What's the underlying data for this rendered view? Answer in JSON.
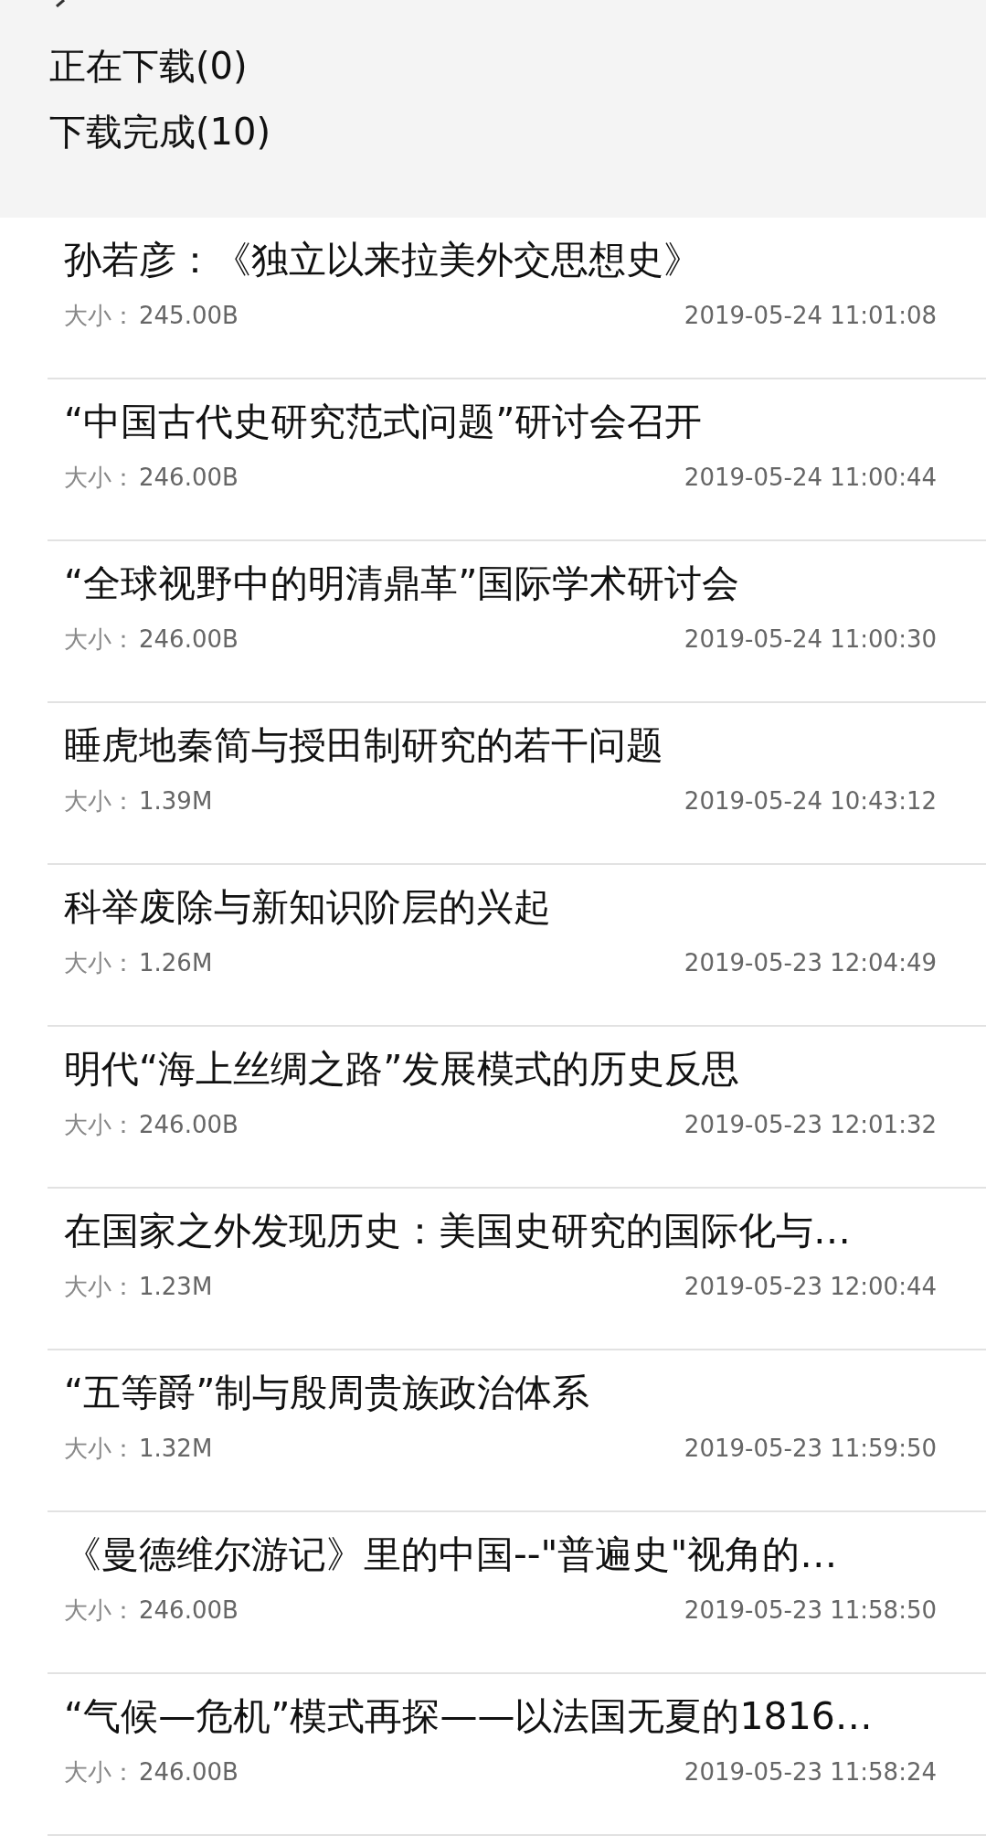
{
  "header": {
    "sections": [
      {
        "label": "正在下载(0)"
      },
      {
        "label": "下载完成(10)"
      }
    ]
  },
  "downloads": [
    {
      "title": "孙若彦：《独立以来拉美外交思想史》",
      "size_label": "大小：",
      "size": "245.00B",
      "time": "2019-05-24 11:01:08"
    },
    {
      "title": "“中国古代史研究范式问题”研讨会召开",
      "size_label": "大小：",
      "size": "246.00B",
      "time": "2019-05-24 11:00:44"
    },
    {
      "title": "“全球视野中的明清鼎革”国际学术研讨会",
      "size_label": "大小：",
      "size": "246.00B",
      "time": "2019-05-24 11:00:30"
    },
    {
      "title": "睡虎地秦简与授田制研究的若干问题",
      "size_label": "大小：",
      "size": "1.39M",
      "time": "2019-05-24 10:43:12"
    },
    {
      "title": "科举废除与新知识阶层的兴起",
      "size_label": "大小：",
      "size": "1.26M",
      "time": "2019-05-23 12:04:49"
    },
    {
      "title": "明代“海上丝绸之路”发展模式的历史反思",
      "size_label": "大小：",
      "size": "246.00B",
      "time": "2019-05-23 12:01:32"
    },
    {
      "title": "在国家之外发现历史：美国史研究的国际化与…",
      "size_label": "大小：",
      "size": "1.23M",
      "time": "2019-05-23 12:00:44"
    },
    {
      "title": "“五等爵”制与殷周贵族政治体系",
      "size_label": "大小：",
      "size": "1.32M",
      "time": "2019-05-23 11:59:50"
    },
    {
      "title": "《曼德维尔游记》里的中国--\"普遍史\"视角的…",
      "size_label": "大小：",
      "size": "246.00B",
      "time": "2019-05-23 11:58:50"
    },
    {
      "title": "“气候—危机”模式再探——以法国无夏的1816…",
      "size_label": "大小：",
      "size": "246.00B",
      "time": "2019-05-23 11:58:24"
    }
  ]
}
